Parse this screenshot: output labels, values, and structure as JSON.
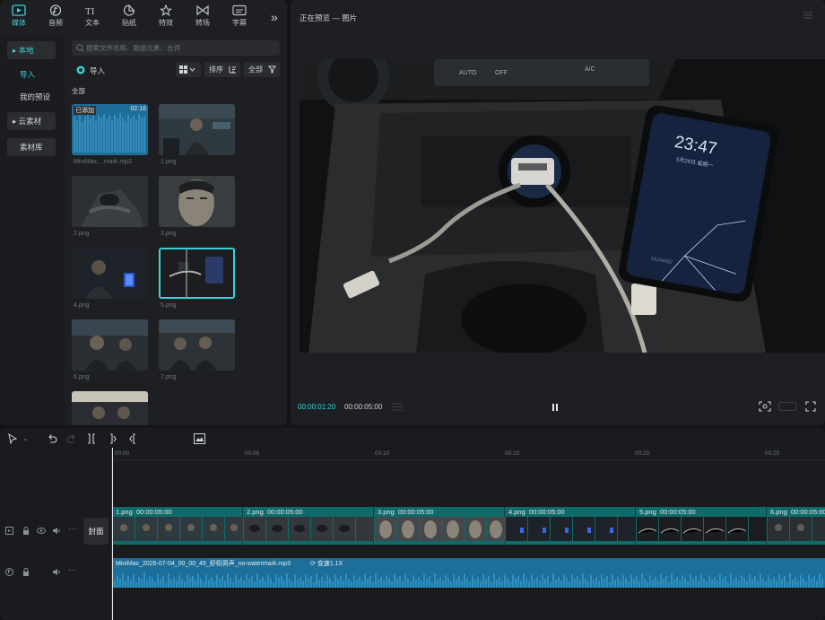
{
  "media_panel": {
    "tabs": [
      {
        "label": "媒体",
        "icon": "media-icon"
      },
      {
        "label": "音频",
        "icon": "audio-icon"
      },
      {
        "label": "文本",
        "icon": "text-icon"
      },
      {
        "label": "贴纸",
        "icon": "sticker-icon"
      },
      {
        "label": "特效",
        "icon": "effects-icon"
      },
      {
        "label": "转场",
        "icon": "transition-icon"
      },
      {
        "label": "字幕",
        "icon": "subtitle-icon"
      }
    ],
    "more_glyph": "»",
    "sidebar": {
      "local": "本地",
      "import": "导入",
      "my_presets": "我的预设",
      "cloud": "云素材",
      "library": "素材库"
    },
    "search_placeholder": "搜索文件名称、歌曲元素、台词",
    "import_label": "导入",
    "sort_label": "排序",
    "filter_label": "全部",
    "section_label": "全部",
    "items": [
      {
        "name": "MiniMax....mark.mp3",
        "badge": "已添加",
        "duration": "02:16"
      },
      {
        "name": "1.png"
      },
      {
        "name": "2.png"
      },
      {
        "name": "3.png"
      },
      {
        "name": "4.png"
      },
      {
        "name": "5.png"
      },
      {
        "name": "6.png"
      },
      {
        "name": "7.png"
      },
      {
        "name": ""
      }
    ]
  },
  "preview": {
    "title": "正在预览 — 图片",
    "current_time": "00:00:01:20",
    "total_time": "00:00:05:00",
    "phone_time": "23:47",
    "phone_date": "5月26日 星期一",
    "phone_brand": "HUAWEI",
    "car_buttons": [
      "AUTO",
      "OFF",
      "",
      "",
      "A/C",
      ""
    ]
  },
  "timeline": {
    "ruler": [
      "00:00",
      "00:05",
      "00:10",
      "00:15",
      "00:20",
      "00:25"
    ],
    "cover_label": "封面",
    "video_clips": [
      {
        "label": "1.png",
        "duration": "00:00:05:00"
      },
      {
        "label": "2.png",
        "duration": "00:00:05:00"
      },
      {
        "label": "3.png",
        "duration": "00:00:05:00"
      },
      {
        "label": "4.png",
        "duration": "00:00:05:00"
      },
      {
        "label": "5.png",
        "duration": "00:00:05:00"
      },
      {
        "label": "6.png",
        "duration": "00:00:05:00"
      }
    ],
    "audio_clip": {
      "name": "MiniMax_2026-07-04_00_00_49_舒栩男声_no-watermark.mp3",
      "speed": "变速1.1X"
    }
  },
  "colors": {
    "accent": "#3ad1d9",
    "panel": "#1e1f22",
    "audio": "#1d6f9a",
    "video_track": "#0f6b6a"
  }
}
